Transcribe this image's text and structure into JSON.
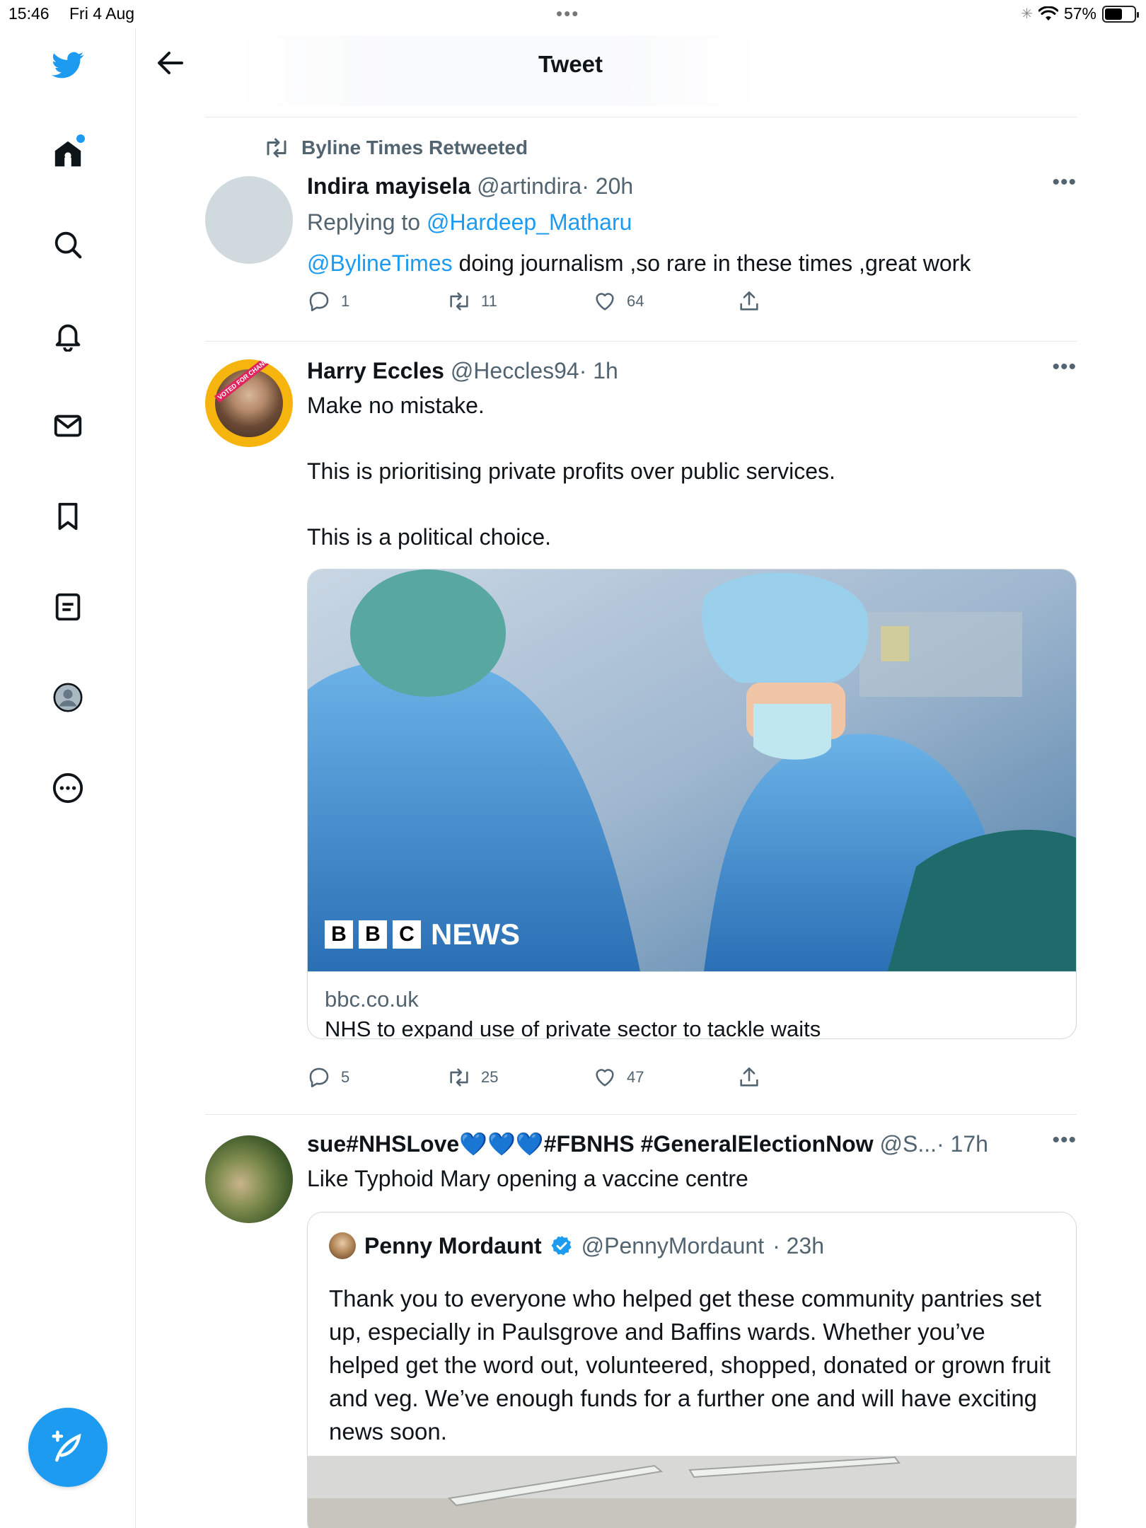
{
  "status_bar": {
    "time": "15:46",
    "date": "Fri 4 Aug",
    "battery": "57%"
  },
  "header": {
    "title": "Tweet"
  },
  "sidebar": {
    "items": [
      "twitter-logo",
      "home",
      "search",
      "notifications",
      "messages",
      "bookmarks",
      "lists",
      "profile",
      "more"
    ],
    "home_has_badge": true
  },
  "tweets": [
    {
      "social_context": "Byline Times Retweeted",
      "name": "Indira mayisela",
      "handle": "@artindira",
      "time": "· 20h",
      "reply_prefix": "Replying to",
      "reply_to": "@Hardeep_Matharu",
      "mention": "@BylineTimes",
      "text": " doing journalism ,so rare in these times ,great work",
      "replies": "1",
      "retweets": "11",
      "likes": "64"
    },
    {
      "name": "Harry Eccles",
      "handle": "@Heccles94",
      "time": "· 1h",
      "avatar_badge_text": "VOTED FOR CHANGE",
      "line1": "Make no mistake.",
      "line2": "This is prioritising private profits over public services.",
      "line3": "This is a political choice.",
      "card": {
        "image_logo": "NEWS",
        "domain": "bbc.co.uk",
        "title": "NHS to expand use of private sector to tackle waits"
      },
      "replies": "5",
      "retweets": "25",
      "likes": "47"
    },
    {
      "name": "sue#NHSLove💙💙💙#FBNHS #GeneralElectionNow",
      "handle": "@S...",
      "time": "· 17h",
      "text": "Like Typhoid Mary opening a vaccine centre",
      "quote": {
        "name": "Penny Mordaunt",
        "handle": "@PennyMordaunt",
        "time": "· 23h",
        "text": "Thank you to everyone who helped get these community pantries set up, especially in Paulsgrove and Baffins wards. Whether you’ve helped get the word out, volunteered, shopped, donated or grown fruit and veg. We’ve enough funds for a further one and will have exciting news soon."
      }
    }
  ],
  "colors": {
    "accent": "#1d9bf0",
    "muted": "#536471",
    "text": "#0f1419",
    "border": "#e5e8eb"
  }
}
